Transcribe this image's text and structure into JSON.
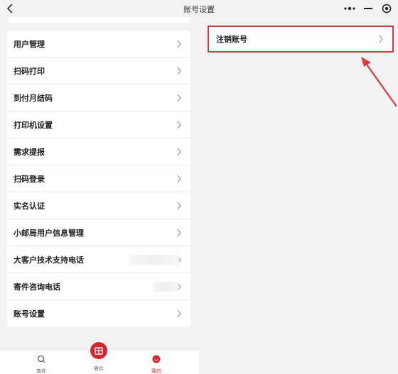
{
  "header": {
    "title": "账号设置"
  },
  "menu": {
    "items": [
      {
        "label": "用户管理"
      },
      {
        "label": "扫码打印"
      },
      {
        "label": "到付月结码"
      },
      {
        "label": "打印机设置"
      },
      {
        "label": "需求提报"
      },
      {
        "label": "扫码登录"
      },
      {
        "label": "实名认证"
      },
      {
        "label": "小邮局用户信息管理"
      },
      {
        "label": "大客户技术支持电话"
      },
      {
        "label": "寄件咨询电话"
      },
      {
        "label": "账号设置"
      }
    ]
  },
  "tabbar": {
    "tabs": [
      {
        "label": "查件"
      },
      {
        "label": "寄件"
      },
      {
        "label": "我的"
      }
    ]
  },
  "account_settings": {
    "cancel_account_label": "注销账号"
  },
  "colors": {
    "accent": "#d9232d",
    "highlight_border": "#e0353d",
    "background": "#f2f2f2"
  }
}
